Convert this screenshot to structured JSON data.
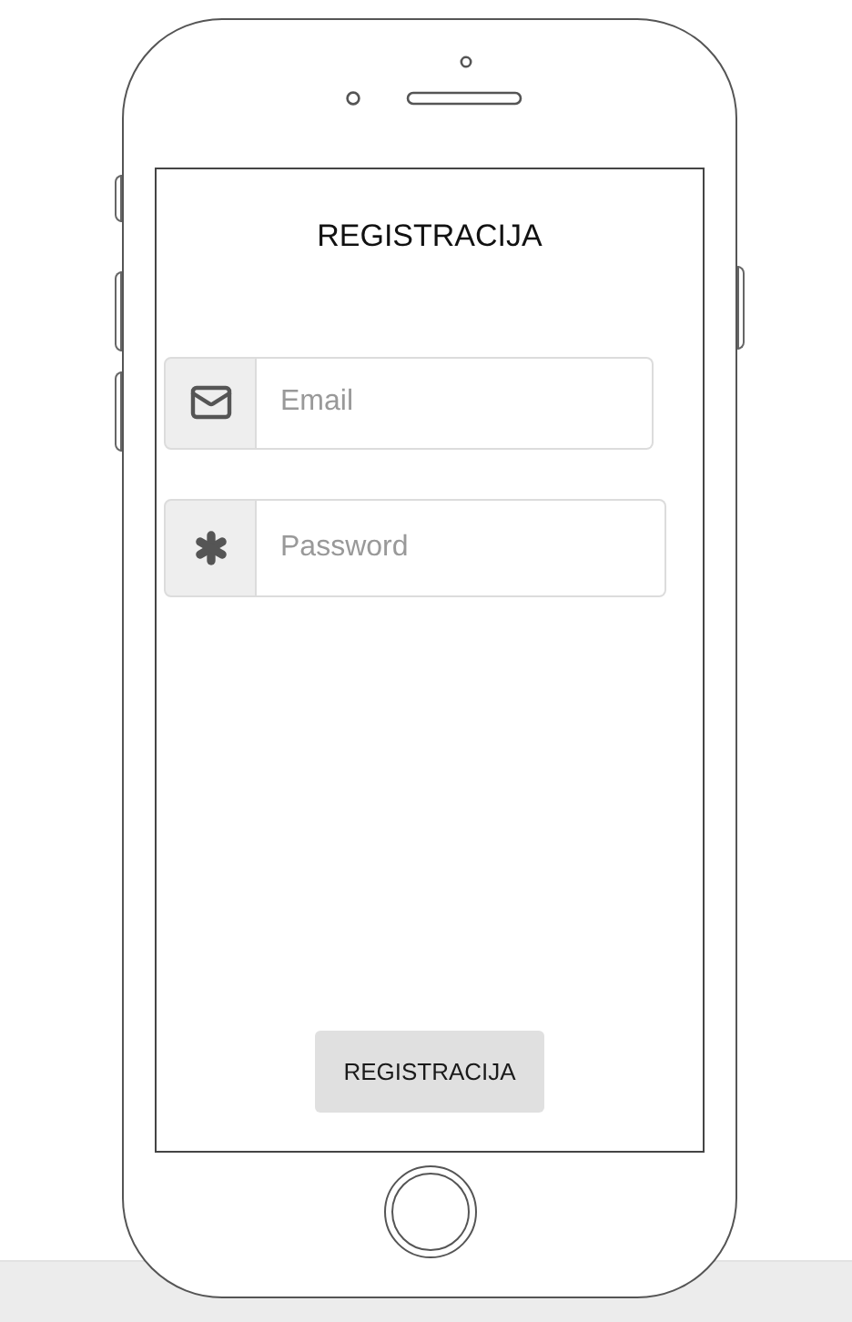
{
  "title": "REGISTRACIJA",
  "fields": [
    {
      "kind": "email",
      "placeholder": "Email"
    },
    {
      "kind": "password",
      "placeholder": "Password"
    }
  ],
  "button": {
    "label": "REGISTRACIJA"
  }
}
